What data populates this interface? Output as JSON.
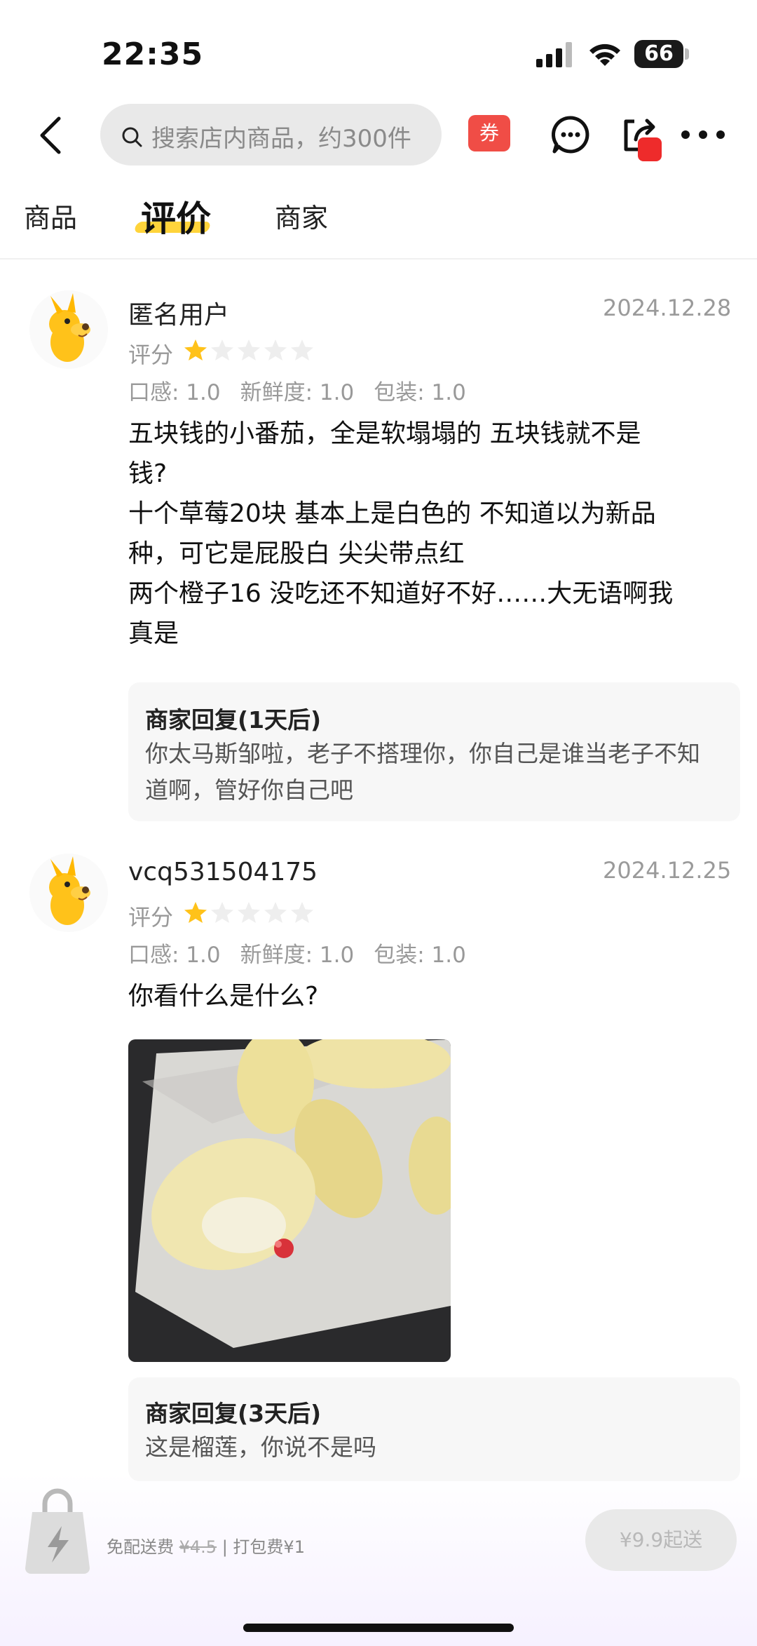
{
  "status_bar": {
    "time": "22:35",
    "battery": "66"
  },
  "nav": {
    "search_placeholder": "搜索店内商品，约300件",
    "coupon_label": "券"
  },
  "tabs": [
    {
      "label": "商品"
    },
    {
      "label": "评价"
    },
    {
      "label": "商家"
    }
  ],
  "active_tab": "评价",
  "reviews": [
    {
      "username": "匿名用户",
      "date": "2024.12.28",
      "rating_label": "评分",
      "rating": 1,
      "scores": [
        "口感: 1.0",
        "新鲜度: 1.0",
        "包装: 1.0"
      ],
      "content_lines": [
        "五块钱的小番茄，全是软塌塌的 五块钱就不是",
        "钱?",
        "十个草莓20块 基本上是白色的 不知道以为新品",
        "种，可它是屁股白 尖尖带点红",
        "两个橙子16 没吃还不知道好不好……大无语啊我",
        "真是"
      ],
      "reply_title": "商家回复(1天后)",
      "reply_lines": [
        "你太马斯邹啦，老子不搭理你，你自己是谁当老子不知",
        "道啊，管好你自己吧"
      ]
    },
    {
      "username": "vcq531504175",
      "date": "2024.12.25",
      "rating_label": "评分",
      "rating": 1,
      "scores": [
        "口感: 1.0",
        "新鲜度: 1.0",
        "包装: 1.0"
      ],
      "content_lines": [
        "你看什么是什么?"
      ],
      "reply_title": "商家回复(3天后)",
      "reply_lines": [
        "这是榴莲，你说不是吗"
      ]
    }
  ],
  "bottom_bar": {
    "free_delivery": "免配送费",
    "original_fee": "¥4.5",
    "packing_fee": "| 打包费¥1",
    "min_order": "¥9.9起送"
  },
  "colors": {
    "accent_yellow": "#ffd43b",
    "coupon_red": "#f04d46",
    "star_gold": "#ffc21a",
    "star_empty": "#eeeeee"
  }
}
